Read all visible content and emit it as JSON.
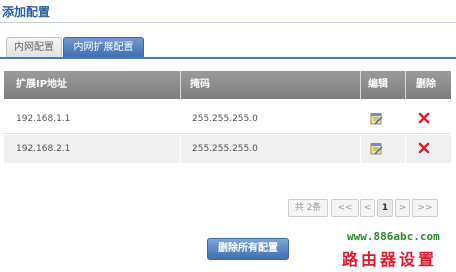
{
  "page": {
    "title": "添加配置"
  },
  "tabs": [
    {
      "label": "内网配置",
      "active": false
    },
    {
      "label": "内网扩展配置",
      "active": true
    }
  ],
  "table": {
    "headers": {
      "ip": "扩展IP地址",
      "mask": "掩码",
      "edit": "编辑",
      "delete": "删除"
    },
    "rows": [
      {
        "ip": "192.168.1.1",
        "mask": "255.255.255.0"
      },
      {
        "ip": "192.168.2.1",
        "mask": "255.255.255.0"
      }
    ]
  },
  "pagination": {
    "total": "共 2条",
    "first": "<<",
    "prev": "<",
    "current": "1",
    "next": ">",
    "last": ">>"
  },
  "actions": {
    "delete_all": "删除所有配置"
  },
  "watermark": {
    "url": "www.886abc.com",
    "text": "路由器设置"
  },
  "colors": {
    "accent": "#3f6eb0",
    "delete": "#d9222a",
    "watermark_url": "#2a8a2a",
    "watermark_text": "#e0182d"
  },
  "icons": {
    "edit": "edit-note-icon",
    "delete": "delete-x-icon"
  }
}
